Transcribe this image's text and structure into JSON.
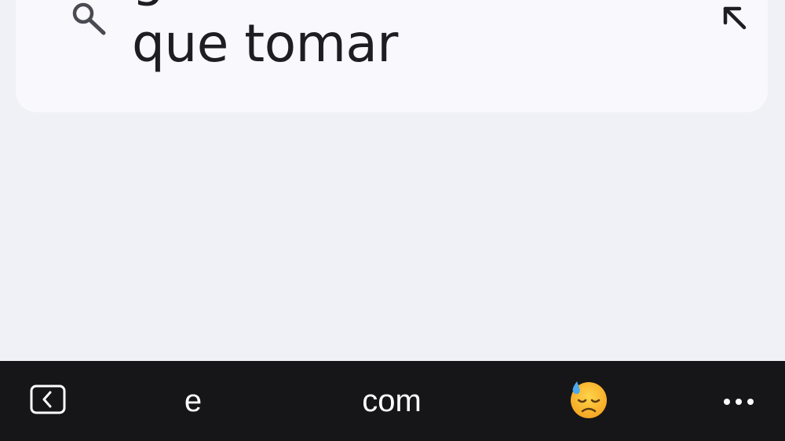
{
  "suggestion": {
    "lines": [
      "ganas de",
      "que tomar"
    ]
  },
  "keyboard_bar": {
    "back_icon": "keyboard-back-icon",
    "word_suggestions": [
      "e",
      "com"
    ],
    "emoji_suggestion": "downcast-face-with-sweat-emoji",
    "more_icon": "more-horizontal-icon"
  },
  "colors": {
    "page_background": "#f0f1f6",
    "card_background": "#f8f8fd",
    "text": "#1d1d22",
    "keyboard_bar": "#161618"
  }
}
